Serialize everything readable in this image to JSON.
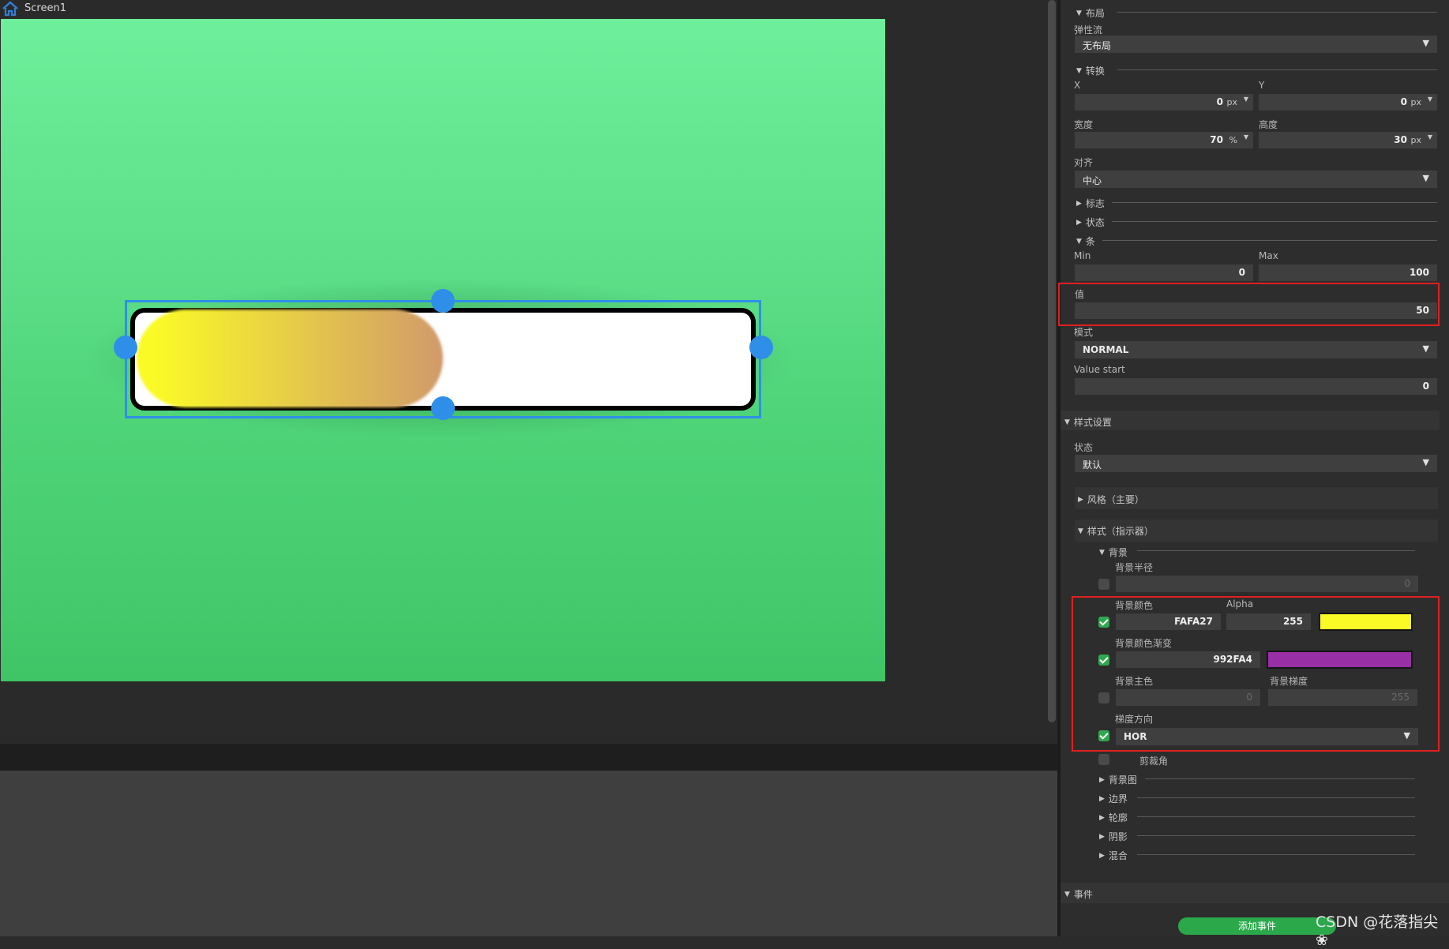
{
  "editor": {
    "screen_tab": "Screen1",
    "icons": {
      "home": "home-icon"
    },
    "canvas": {
      "bar_value_fraction": 0.5,
      "indicator_gradient": [
        "#FAFA27",
        "#D19A6B"
      ]
    }
  },
  "inspector": {
    "layout": {
      "header": "布局",
      "flex_label": "弹性流",
      "flex_value": "无布局"
    },
    "transform": {
      "header": "转换",
      "x_label": "X",
      "x_value": "0",
      "x_unit": "px",
      "y_label": "Y",
      "y_value": "0",
      "y_unit": "px",
      "width_label": "宽度",
      "width_value": "70",
      "width_unit": "%",
      "height_label": "高度",
      "height_value": "30",
      "height_unit": "px",
      "align_label": "对齐",
      "align_value": "中心"
    },
    "flags_header": "标志",
    "states_header": "状态",
    "bar": {
      "header": "条",
      "min_label": "Min",
      "min_value": "0",
      "max_label": "Max",
      "max_value": "100",
      "value_label": "值",
      "value": "50",
      "mode_label": "模式",
      "mode_value": "NORMAL",
      "value_start_label": "Value start",
      "value_start": "0"
    },
    "style_settings": {
      "header": "样式设置",
      "state_label": "状态",
      "state_value": "默认",
      "main_style": "风格（主要）",
      "indicator_style": "样式（指示器）",
      "background": {
        "header": "背景",
        "radius_label": "背景半径",
        "radius_value": "0",
        "color_label": "背景颜色",
        "alpha_label": "Alpha",
        "color_value": "FAFA27",
        "alpha_value": "255",
        "color_swatch": "#FAFA27",
        "grad_label": "背景颜色渐变",
        "grad_value": "992FA4",
        "grad_swatch": "#992FA4",
        "main_color_label": "背景主色",
        "main_color_value": "0",
        "grad_stop_label": "背景梯度",
        "grad_stop_value": "255",
        "grad_dir_label": "梯度方向",
        "grad_dir_value": "HOR",
        "clip_label": "剪裁角"
      },
      "subsections": [
        "背景图",
        "边界",
        "轮廓",
        "阴影",
        "混合"
      ]
    },
    "events": {
      "header": "事件",
      "add_button": "添加事件"
    }
  },
  "watermark": "CSDN @花落指尖❀"
}
